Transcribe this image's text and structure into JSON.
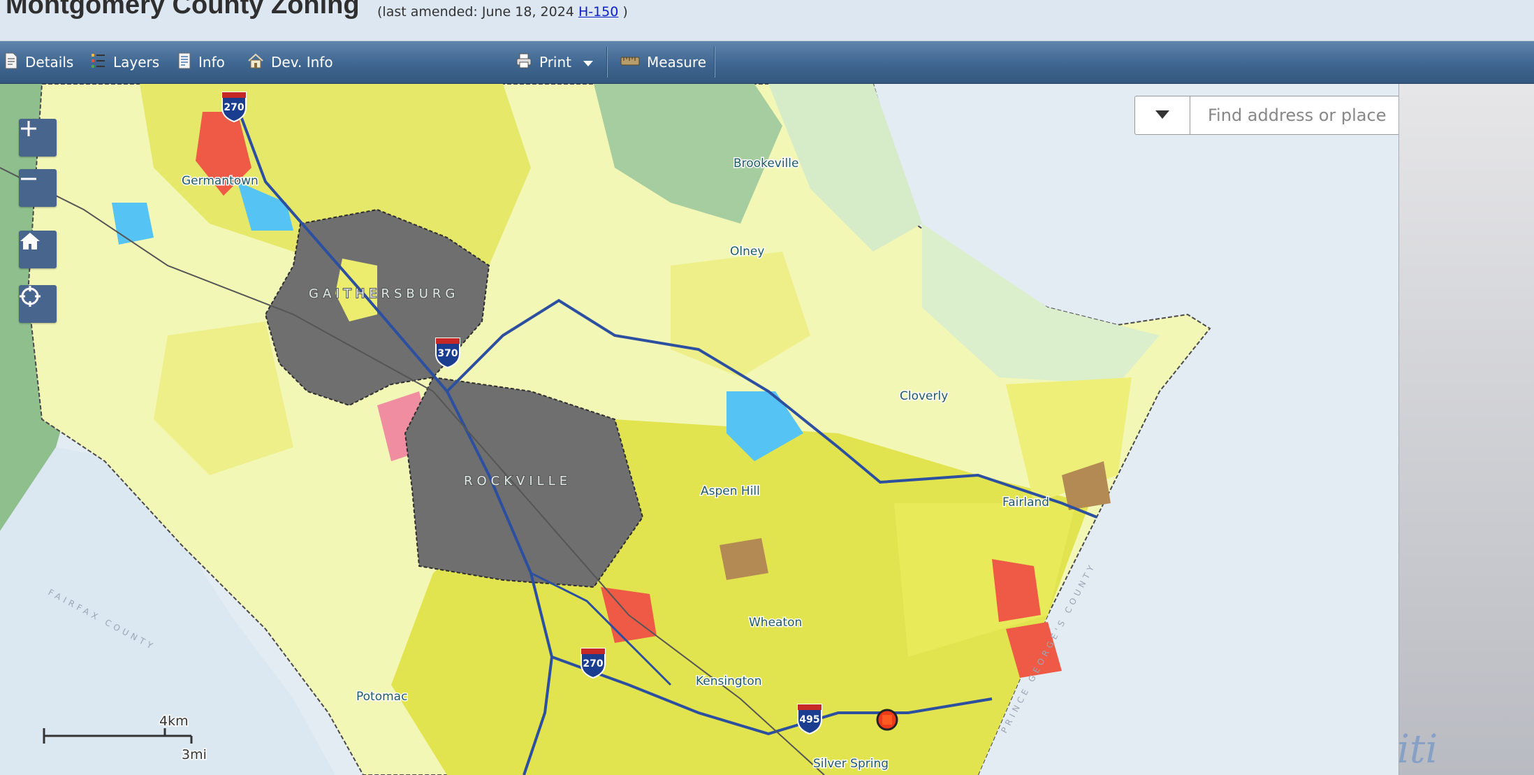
{
  "header": {
    "title": "Montgomery County Zoning",
    "amended_prefix": "(last amended: June 18, 2024",
    "amended_link": "H-150",
    "amended_suffix": ")"
  },
  "toolbar": {
    "details": "Details",
    "layers": "Layers",
    "info": "Info",
    "dev_info": "Dev. Info",
    "print": "Print",
    "measure": "Measure"
  },
  "search": {
    "placeholder": "Find address or place"
  },
  "map": {
    "places": {
      "brookeville": "Brookeville",
      "germantown": "Germantown",
      "olney": "Olney",
      "gaithersburg": "GAITHERSBURG",
      "rockville": "ROCKVILLE",
      "cloverly": "Cloverly",
      "aspen_hill": "Aspen Hill",
      "fairland": "Fairland",
      "wheaton": "Wheaton",
      "kensington": "Kensington",
      "potomac": "Potomac",
      "silver_spring": "Silver Spring"
    },
    "counties": {
      "fairfax": "FAIRFAX COUNTY",
      "prince_georges": "PRINCE GEORGE'S COUNTY"
    },
    "shields": {
      "i270_north": "270",
      "i370": "370",
      "i270_south": "270",
      "i495": "495"
    },
    "scale": {
      "km": "4km",
      "mi": "3mi"
    },
    "colors": {
      "residential_yellow": "#ecec6e",
      "residential_light": "#f6f7b8",
      "municipality_gray": "#6f6f6f",
      "commercial_red": "#ee5a46",
      "parkland_green": "#9fc79b",
      "highway_blue": "#2c4fa0"
    }
  },
  "watermark": "iti"
}
